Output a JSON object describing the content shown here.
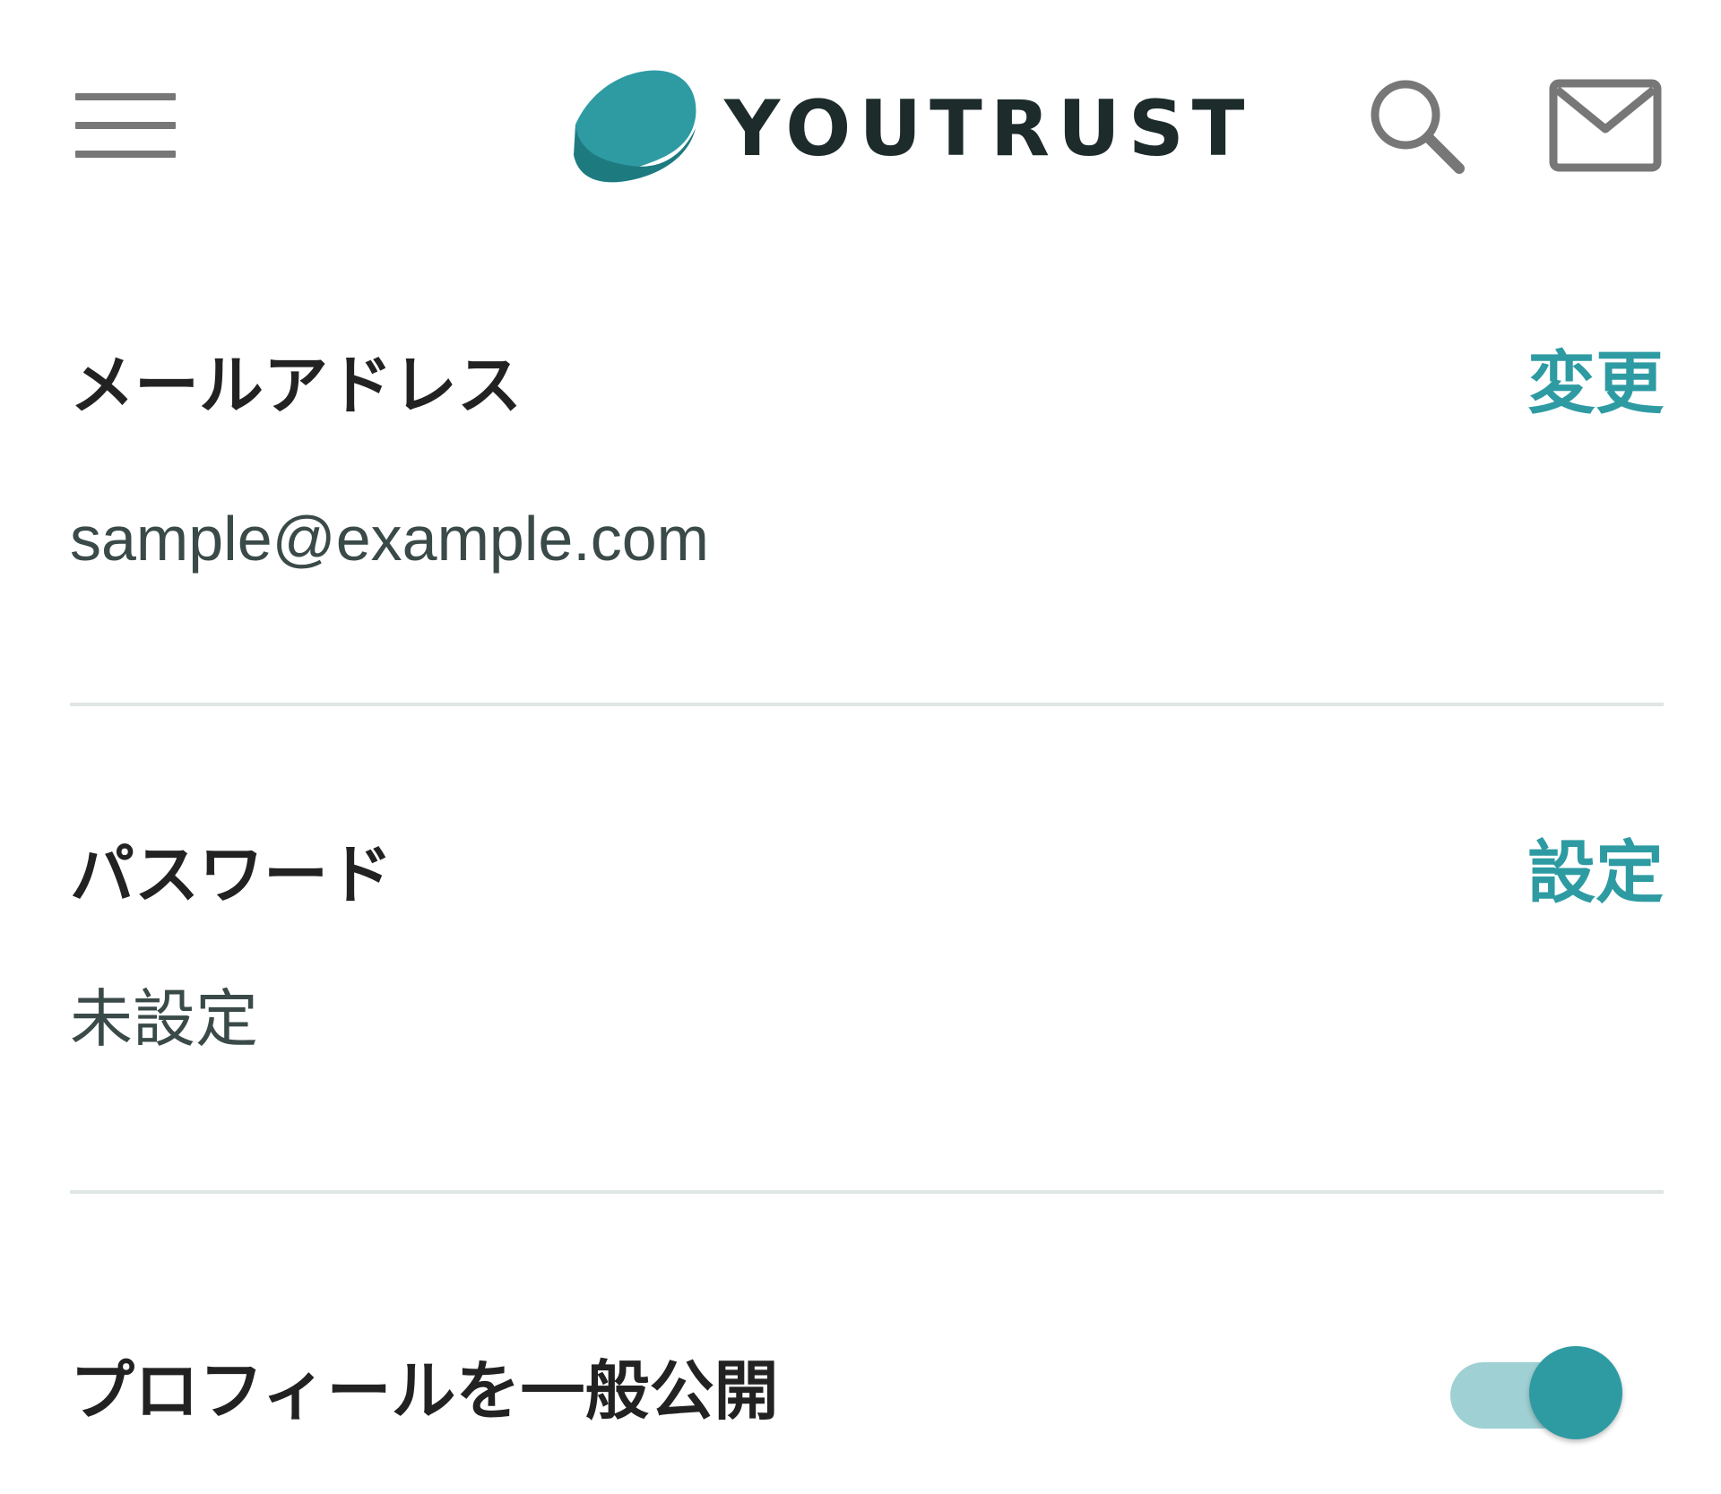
{
  "header": {
    "logo_text": "YOUTRUST",
    "menu_icon": "hamburger-menu-icon",
    "search_icon": "search-icon",
    "mail_icon": "mail-icon"
  },
  "email": {
    "title": "メールアドレス",
    "action": "変更",
    "value": "sample@example.com"
  },
  "password": {
    "title": "パスワード",
    "action": "設定",
    "value": "未設定"
  },
  "profile_public": {
    "title": "プロフィールを一般公開",
    "enabled": true
  },
  "colors": {
    "accent": "#2e9ba3",
    "accent_light": "#9fd0d3",
    "text_dark": "#222222",
    "text_value": "#3a4a48",
    "icon_gray": "#777777",
    "divider": "#e0e6e6"
  }
}
